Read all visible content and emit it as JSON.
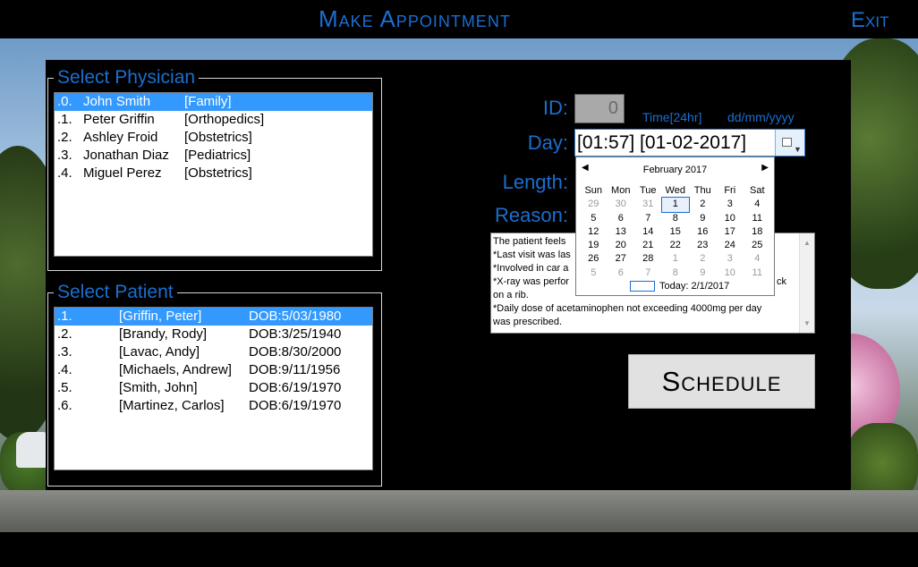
{
  "header": {
    "title": "Make Appointment",
    "exit_label": "Exit"
  },
  "physician": {
    "legend": "Select Physician",
    "items": [
      {
        "index": ".0.",
        "name": "John Smith",
        "specialty": "[Family]",
        "selected": true
      },
      {
        "index": ".1.",
        "name": "Peter Griffin",
        "specialty": "[Orthopedics]",
        "selected": false
      },
      {
        "index": ".2.",
        "name": "Ashley Froid",
        "specialty": "[Obstetrics]",
        "selected": false
      },
      {
        "index": ".3.",
        "name": "Jonathan Diaz",
        "specialty": "[Pediatrics]",
        "selected": false
      },
      {
        "index": ".4.",
        "name": "Miguel Perez",
        "specialty": "[Obstetrics]",
        "selected": false
      }
    ]
  },
  "patient": {
    "legend": "Select Patient",
    "items": [
      {
        "index": ".1.",
        "name": "[Griffin, Peter]",
        "dob": "DOB:5/03/1980",
        "selected": true
      },
      {
        "index": ".2.",
        "name": "[Brandy, Rody]",
        "dob": "DOB:3/25/1940",
        "selected": false
      },
      {
        "index": ".3.",
        "name": "[Lavac, Andy]",
        "dob": "DOB:8/30/2000",
        "selected": false
      },
      {
        "index": ".4.",
        "name": "[Michaels, Andrew]",
        "dob": "DOB:9/11/1956",
        "selected": false
      },
      {
        "index": ".5.",
        "name": "[Smith, John]",
        "dob": "DOB:6/19/1970",
        "selected": false
      },
      {
        "index": ".6.",
        "name": "[Martinez, Carlos]",
        "dob": "DOB:6/19/1970",
        "selected": false
      }
    ]
  },
  "form": {
    "id_label": "ID:",
    "id_value": "0",
    "day_label": "Day:",
    "time_hint": "Time[24hr]",
    "date_hint": "dd/mm/yyyy",
    "day_value": "[01:57] [01-02-2017]",
    "length_label": "Length:",
    "reason_label": "Reason:",
    "reason_lines": [
      "The patient feels",
      "*Last visit was las",
      "*Involved in car a",
      "*X-ray was perfor",
      "on a rib.",
      "*Daily dose of acetaminophen not exceeding 4000mg per day",
      "was prescribed."
    ],
    "reason_line4_tail": "ck",
    "schedule_label": "Schedule"
  },
  "calendar": {
    "month_label": "February 2017",
    "weekdays": [
      "Sun",
      "Mon",
      "Tue",
      "Wed",
      "Thu",
      "Fri",
      "Sat"
    ],
    "weeks": [
      [
        "29",
        "30",
        "31",
        "1",
        "2",
        "3",
        "4"
      ],
      [
        "5",
        "6",
        "7",
        "8",
        "9",
        "10",
        "11"
      ],
      [
        "12",
        "13",
        "14",
        "15",
        "16",
        "17",
        "18"
      ],
      [
        "19",
        "20",
        "21",
        "22",
        "23",
        "24",
        "25"
      ],
      [
        "26",
        "27",
        "28",
        "1",
        "2",
        "3",
        "4"
      ],
      [
        "5",
        "6",
        "7",
        "8",
        "9",
        "10",
        "11"
      ]
    ],
    "today_label": "Today: 2/1/2017"
  },
  "colors": {
    "accent": "#1a6fd0",
    "selection": "#3399ff"
  }
}
